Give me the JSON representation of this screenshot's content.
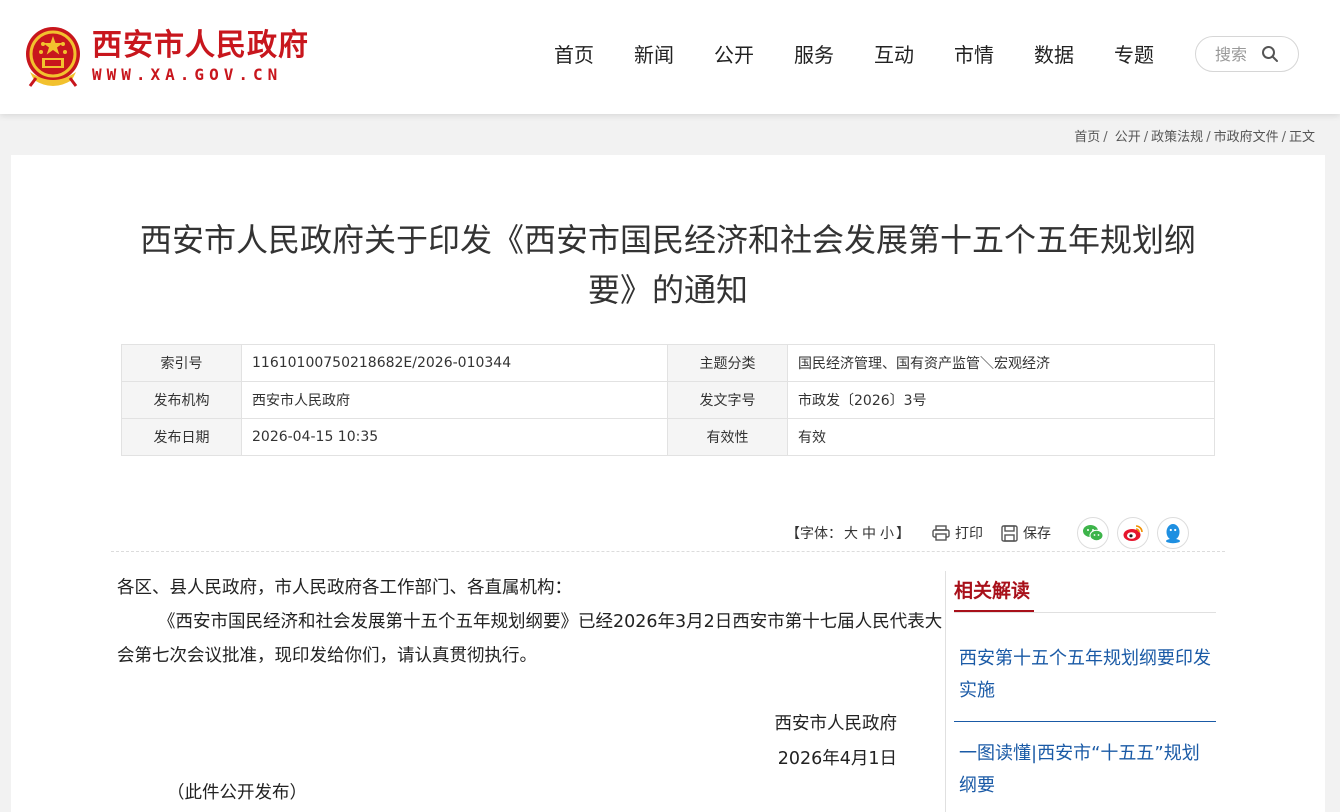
{
  "header": {
    "site_name": "西安市人民政府",
    "site_url": "WWW.XA.GOV.CN",
    "emblem_icon": "national-emblem-icon",
    "brand_color": "#c8161d"
  },
  "nav": [
    "首页",
    "新闻",
    "公开",
    "服务",
    "互动",
    "市情",
    "数据",
    "专题"
  ],
  "search": {
    "placeholder": "搜索",
    "icon": "search-icon"
  },
  "breadcrumb": [
    "首页",
    "公开",
    "政策法规",
    "市政府文件",
    "正文"
  ],
  "breadcrumb_sep": "/",
  "article": {
    "title": "西安市人民政府关于印发《西安市国民经济和社会发展第十五个五年规划纲要》的通知",
    "info": [
      {
        "label": "索引号",
        "value": "11610100750218682E/2026-010344",
        "label2": "主题分类",
        "value2": "国民经济管理、国有资产监管＼宏观经济"
      },
      {
        "label": "发布机构",
        "value": "西安市人民政府",
        "label2": "发文字号",
        "value2": "市政发〔2026〕3号"
      },
      {
        "label": "发布日期",
        "value": "2026-04-15 10:35",
        "label2": "有效性",
        "value2": "有效"
      }
    ],
    "salutation": "各区、县人民政府，市人民政府各工作部门、各直属机构：",
    "body": "《西安市国民经济和社会发展第十五个五年规划纲要》已经2026年3月2日西安市第十七届人民代表大会第七次会议批准，现印发给你们，请认真贯彻执行。",
    "signer": "西安市人民政府",
    "date": "2026年4月1日",
    "note": "（此件公开发布）"
  },
  "tools": {
    "font_label_open": "【字体：",
    "font_large": "大",
    "font_medium": "中",
    "font_small": "小",
    "font_label_close": "】",
    "print": "打印",
    "save": "保存",
    "share_icons": [
      "wechat-icon",
      "weibo-icon",
      "qq-icon"
    ],
    "share_colors": {
      "wechat": "#3db44a",
      "weibo": "#e6162d",
      "qq": "#1e8fe1"
    }
  },
  "related": {
    "title": "相关解读",
    "items": [
      "西安第十五个五年规划纲要印发实施",
      "一图读懂|西安市“十五五”规划纲要"
    ]
  }
}
